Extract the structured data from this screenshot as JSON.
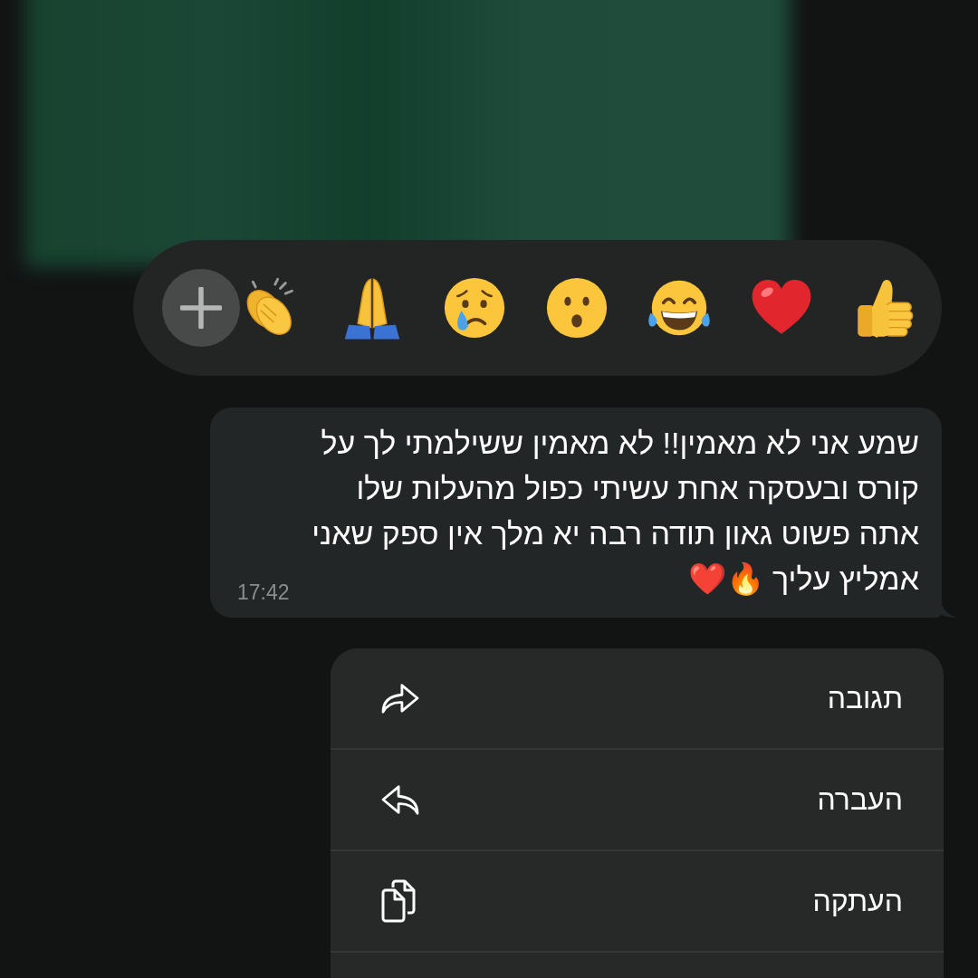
{
  "reaction_bar": {
    "reactions": [
      {
        "kind": "thumbs_up"
      },
      {
        "kind": "heart"
      },
      {
        "kind": "joy"
      },
      {
        "kind": "surprised"
      },
      {
        "kind": "crying"
      },
      {
        "kind": "pray"
      },
      {
        "kind": "clap"
      },
      {
        "kind": "add"
      }
    ]
  },
  "message": {
    "text": "שמע אני לא מאמין!! לא מאמין ששילמתי לך על\nקורס ובעסקה אחת עשיתי כפול מהעלות שלו\nאתה פשוט גאון תודה רבה יא מלך אין ספק שאני\nאמליץ עליך 🔥❤️",
    "time": "17:42"
  },
  "menu": {
    "items": [
      {
        "label": "תגובה",
        "kind": "curve_right"
      },
      {
        "label": "העברה",
        "kind": "curve_left"
      },
      {
        "label": "העתקה",
        "kind": "copy"
      }
    ]
  }
}
